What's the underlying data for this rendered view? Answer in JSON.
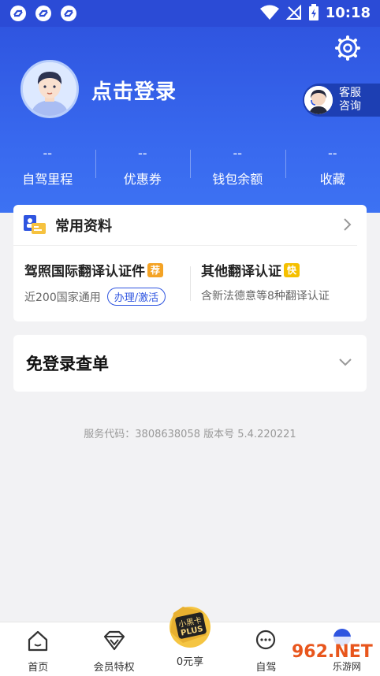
{
  "status_bar": {
    "time": "10:18"
  },
  "header": {
    "login_text": "点击登录",
    "service_label": "客服\n咨询",
    "service_line1": "客服",
    "service_line2": "咨询",
    "stats": [
      {
        "value": "--",
        "label": "自驾里程"
      },
      {
        "value": "--",
        "label": "优惠券"
      },
      {
        "value": "--",
        "label": "钱包余额"
      },
      {
        "value": "--",
        "label": "收藏"
      }
    ]
  },
  "common_info": {
    "title": "常用资料",
    "left": {
      "title": "驾照国际翻译认证件",
      "tag": "荐",
      "desc": "近200国家通用",
      "action": "办理/激活"
    },
    "right": {
      "title": "其他翻译认证",
      "tag": "快",
      "desc": "含新法德意等8种翻译认证"
    }
  },
  "query": {
    "title": "免登录查单"
  },
  "footer": {
    "info": "服务代码：3808638058  版本号 5.4.220221"
  },
  "nav": {
    "items": [
      {
        "label": "首页",
        "icon": "home-icon"
      },
      {
        "label": "会员特权",
        "icon": "diamond-icon"
      },
      {
        "label": "0元享",
        "icon": "plus-card-icon",
        "badge_text": "小黑卡",
        "badge_sub": "PLUS"
      },
      {
        "label": "自驾",
        "icon": "chat-icon"
      },
      {
        "label": "",
        "icon": "profile-icon"
      }
    ]
  },
  "watermark": {
    "text": "962.NET",
    "sub": "乐游网"
  },
  "colors": {
    "primary": "#2f55e0",
    "header_dark": "#1d3fb3",
    "tag_orange": "#f4a325",
    "tag_yellow": "#f5c000"
  }
}
